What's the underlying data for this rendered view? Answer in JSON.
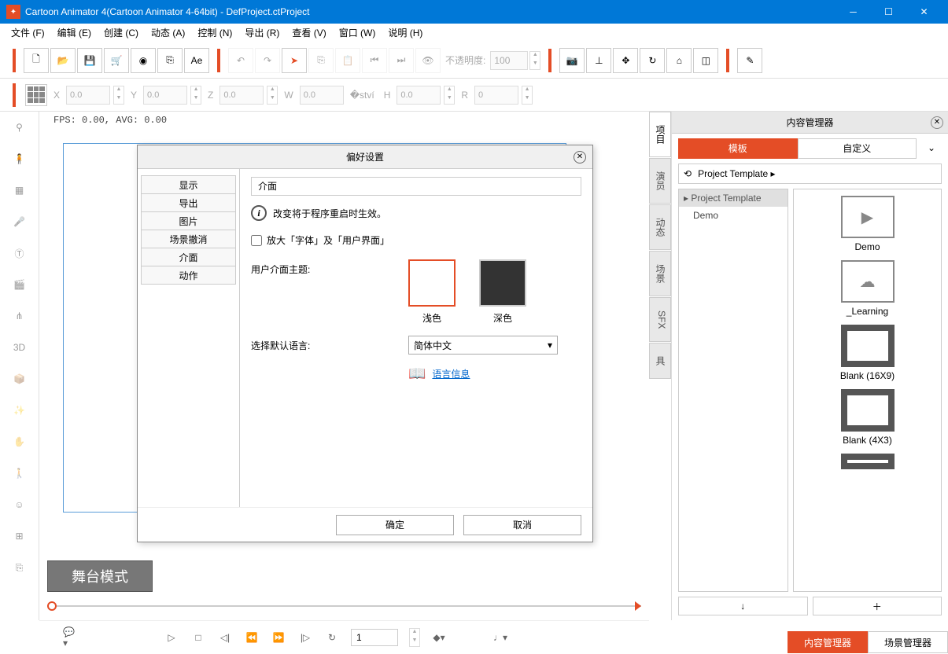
{
  "titlebar": {
    "title": "Cartoon Animator 4(Cartoon Animator 4-64bit) - DefProject.ctProject"
  },
  "menu": {
    "items": [
      "文件 (F)",
      "编辑 (E)",
      "创建 (C)",
      "动态 (A)",
      "控制 (N)",
      "导出 (R)",
      "查看 (V)",
      "窗口 (W)",
      "说明 (H)"
    ]
  },
  "toolbar": {
    "opacity_label": "不透明度:",
    "opacity_value": "100"
  },
  "coords": {
    "x_label": "X",
    "x": "0.0",
    "y_label": "Y",
    "y": "0.0",
    "z_label": "Z",
    "z": "0.0",
    "w_label": "W",
    "w": "0.0",
    "h_label": "H",
    "h": "0.0",
    "r_label": "R",
    "r": "0"
  },
  "stage": {
    "fps": "FPS: 0.00, AVG: 0.00",
    "mode": "舞台模式"
  },
  "content_mgr": {
    "title": "内容管理器",
    "tabs": {
      "template": "模板",
      "custom": "自定义"
    },
    "path": "Project Template ▸",
    "tree_header": "▸ Project Template",
    "tree_items": [
      "Demo"
    ],
    "items": [
      {
        "label": "Demo",
        "icon": "folder"
      },
      {
        "label": "_Learning",
        "icon": "cloud"
      },
      {
        "label": "Blank (16X9)",
        "icon": "blank"
      },
      {
        "label": "Blank (4X3)",
        "icon": "blank"
      }
    ]
  },
  "right_tabs": [
    "项目",
    "演员",
    "动态",
    "场景",
    "SFX",
    "具"
  ],
  "bottom_tabs": {
    "content": "内容管理器",
    "scene": "场景管理器"
  },
  "playback": {
    "frame": "1"
  },
  "dialog": {
    "title": "偏好设置",
    "categories": [
      "显示",
      "导出",
      "图片",
      "场景撤消",
      "介面",
      "动作"
    ],
    "breadcrumb": "介面",
    "info": "改变将于程序重启时生效。",
    "checkbox": "放大「字体」及「用户界面」",
    "theme_label": "用户介面主题:",
    "theme_light": "浅色",
    "theme_dark": "深色",
    "lang_label": "选择默认语言:",
    "lang_value": "简体中文",
    "lang_link": "语言信息",
    "ok": "确定",
    "cancel": "取消"
  }
}
